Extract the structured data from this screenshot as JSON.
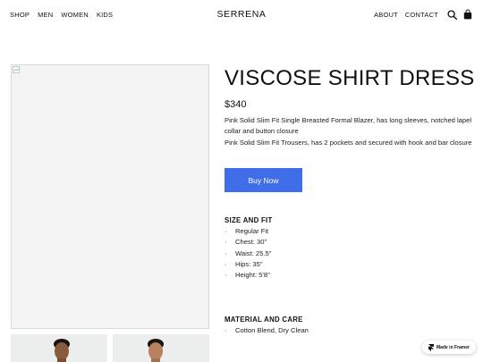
{
  "nav": {
    "left": [
      "SHOP",
      "MEN",
      "WOMEN",
      "KIDS"
    ],
    "brand": "SERRENA",
    "right": [
      "ABOUT",
      "CONTACT"
    ]
  },
  "product": {
    "title": "VISCOSE SHIRT DRESS",
    "price": "$340",
    "description": [
      "Pink Solid Slim Fit Single Breasted Formal Blazer, has long sleeves, notched lapel collar and button closure",
      "Pink Solid Slim Fit Trousers, has 2 pockets and secured with hook and bar closure"
    ],
    "buy_label": "Buy Now"
  },
  "size_fit": {
    "title": "SIZE AND FIT",
    "items": [
      "Regular Fit",
      "Chest: 30''",
      "Waist: 25.5''",
      "Hips: 35''",
      "Height: 5'8''"
    ]
  },
  "material": {
    "title": "MATERIAL AND CARE",
    "items": [
      "Cotton Blend, Dry Clean"
    ]
  },
  "badge": {
    "label": "Made in Framer"
  },
  "colors": {
    "accent": "#3f6ee8",
    "placeholder_bg": "#f3f4f3"
  }
}
